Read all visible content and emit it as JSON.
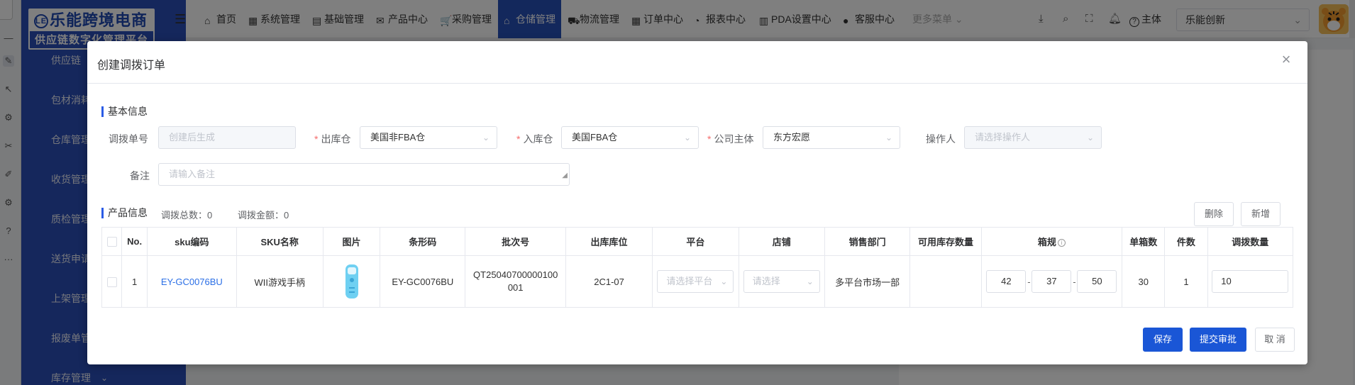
{
  "sidebar": {
    "logo_line1": "乐能跨境电商",
    "logo_line2": "供应链数字化管理平台",
    "items": [
      {
        "label": "供应链"
      },
      {
        "label": "包材消耗"
      },
      {
        "label": "仓库管理"
      },
      {
        "label": "收货管理"
      },
      {
        "label": "质检管理"
      },
      {
        "label": "送货申请"
      },
      {
        "label": "上架管理"
      },
      {
        "label": "报废单管理"
      },
      {
        "label": "库存管理"
      }
    ]
  },
  "topnav": {
    "items": [
      {
        "label": "首页",
        "icon": "home-icon"
      },
      {
        "label": "系统管理",
        "icon": "system-icon"
      },
      {
        "label": "基础管理",
        "icon": "grid-icon"
      },
      {
        "label": "产品中心",
        "icon": "mail-icon"
      },
      {
        "label": "采购管理",
        "icon": "cart-icon"
      },
      {
        "label": "仓储管理",
        "icon": "warehouse-icon"
      },
      {
        "label": "物流管理",
        "icon": "truck-icon"
      },
      {
        "label": "订单中心",
        "icon": "calendar-icon"
      },
      {
        "label": "报表中心",
        "icon": "pie-icon"
      },
      {
        "label": "PDA设置中心",
        "icon": "device-icon"
      },
      {
        "label": "客服中心",
        "icon": "user-icon"
      },
      {
        "label": "更多菜单",
        "icon": ""
      }
    ],
    "entity_label": "主体",
    "entity_value": "乐能创新"
  },
  "dialog": {
    "title": "创建调拨订单",
    "basic_section": "基本信息",
    "fields": {
      "order_no_label": "调拨单号",
      "order_no_placeholder": "创建后生成",
      "out_wh_label": "出库仓",
      "out_wh_value": "美国非FBA仓",
      "in_wh_label": "入库仓",
      "in_wh_value": "美国FBA仓",
      "company_label": "公司主体",
      "company_value": "东方宏愿",
      "operator_label": "操作人",
      "operator_placeholder": "请选择操作人",
      "remark_label": "备注",
      "remark_placeholder": "请输入备注"
    },
    "product_section": "产品信息",
    "total_qty_label": "调拨总数：",
    "total_qty": "0",
    "total_amount_label": "调拨金额：",
    "total_amount": "0",
    "delete_label": "删除",
    "add_label": "新增",
    "columns": [
      "No.",
      "sku编码",
      "SKU名称",
      "图片",
      "条形码",
      "批次号",
      "出库库位",
      "平台",
      "店铺",
      "销售部门",
      "可用库存数量",
      "箱规",
      "单箱数",
      "件数",
      "调拨数量"
    ],
    "rows": [
      {
        "no": "1",
        "sku": "EY-GC0076BU",
        "name": "WII游戏手柄",
        "barcode": "EY-GC0076BU",
        "batch": "QT25040700000100001",
        "location": "2C1-07",
        "platform_placeholder": "请选择平台",
        "shop_placeholder": "请选择",
        "dept": "多平台市场一部",
        "available": "",
        "box_l": "42",
        "box_w": "37",
        "box_h": "50",
        "per_box": "30",
        "pieces": "1",
        "transfer_qty": "10"
      }
    ],
    "save_label": "保存",
    "submit_label": "提交审批",
    "cancel_label": "取 消"
  },
  "colors": {
    "sidebar": "#2b4fb8",
    "primary": "#1a56d6",
    "required": "#f56c6c",
    "link": "#2b6fe6"
  }
}
